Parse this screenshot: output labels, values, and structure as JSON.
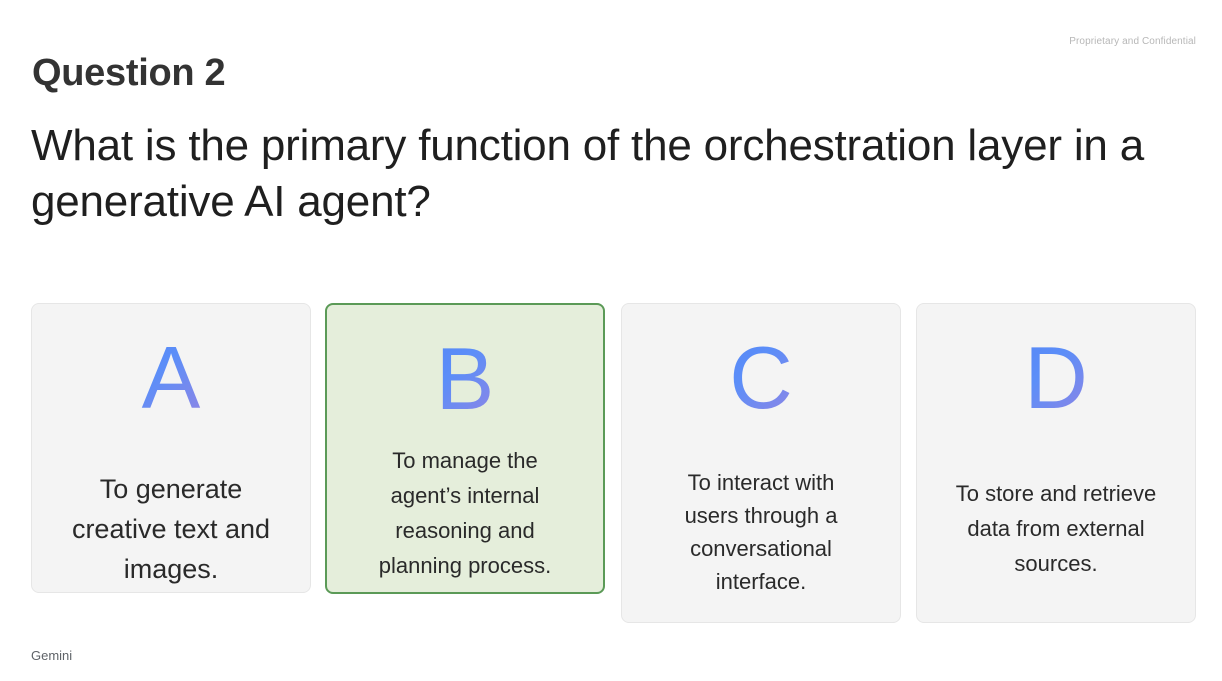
{
  "slide": {
    "confidential": "Proprietary and Confidential",
    "question_label": "Question 2",
    "question_text": "What is the primary function of the orchestration layer in a generative AI agent?",
    "footer": "Gemini"
  },
  "options": [
    {
      "letter": "A",
      "text": "To generate creative text and images.",
      "selected": false
    },
    {
      "letter": "B",
      "text": "To manage the agent’s internal reasoning and planning process.",
      "selected": true
    },
    {
      "letter": "C",
      "text": "To interact with users through a conversational interface.",
      "selected": false
    },
    {
      "letter": "D",
      "text": "To store and retrieve data from external sources.",
      "selected": false
    }
  ],
  "colors": {
    "selected_background": "#e5eedb",
    "selected_border": "#5b9a57",
    "card_background": "#f4f4f4",
    "letter_gradient_start": "#4a7cf2",
    "letter_gradient_end": "#c58fd8"
  }
}
